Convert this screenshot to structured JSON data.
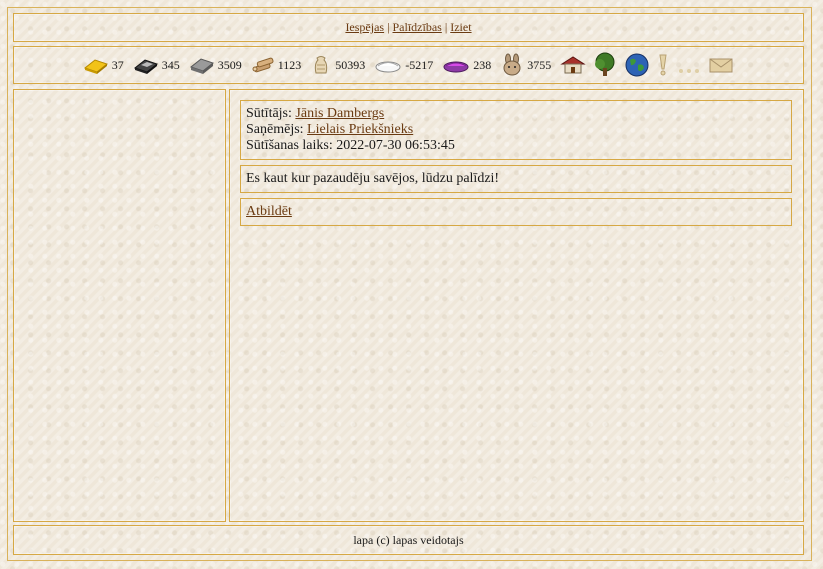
{
  "nav": {
    "links": [
      "Iespējas",
      "Palīdzības",
      "Iziet"
    ],
    "separator": "|"
  },
  "resources": [
    {
      "icon": "gold-bar-icon",
      "value": "37"
    },
    {
      "icon": "iron-bar-icon",
      "value": "345"
    },
    {
      "icon": "stone-block-icon",
      "value": "3509"
    },
    {
      "icon": "wood-logs-icon",
      "value": "1123"
    },
    {
      "icon": "grain-sack-icon",
      "value": "50393"
    },
    {
      "icon": "salt-bowl-icon",
      "value": "-5217"
    },
    {
      "icon": "dye-bowl-icon",
      "value": "238"
    },
    {
      "icon": "rabbit-icon",
      "value": "3755"
    }
  ],
  "toolbar_icons": [
    "house-icon",
    "tree-icon",
    "globe-icon",
    "exclamation-icon",
    "ellipsis-icon",
    "envelope-icon"
  ],
  "message": {
    "sender_label": "Sūtītājs:",
    "sender": "Jānis Dambergs",
    "recipient_label": "Saņēmējs:",
    "recipient": "Lielais Priekšnieks",
    "sent_label": "Sūtīšanas laiks:",
    "sent_time": "2022-07-30 06:53:45",
    "body": "Es kaut kur pazaudēju savējos, lūdzu palīdzi!",
    "reply_label": "Atbildēt"
  },
  "footer": {
    "text": "lapa (c) lapas veidotajs"
  },
  "colors": {
    "border": "#d6a844",
    "link": "#6b3b12",
    "background": "#efe7d9"
  }
}
